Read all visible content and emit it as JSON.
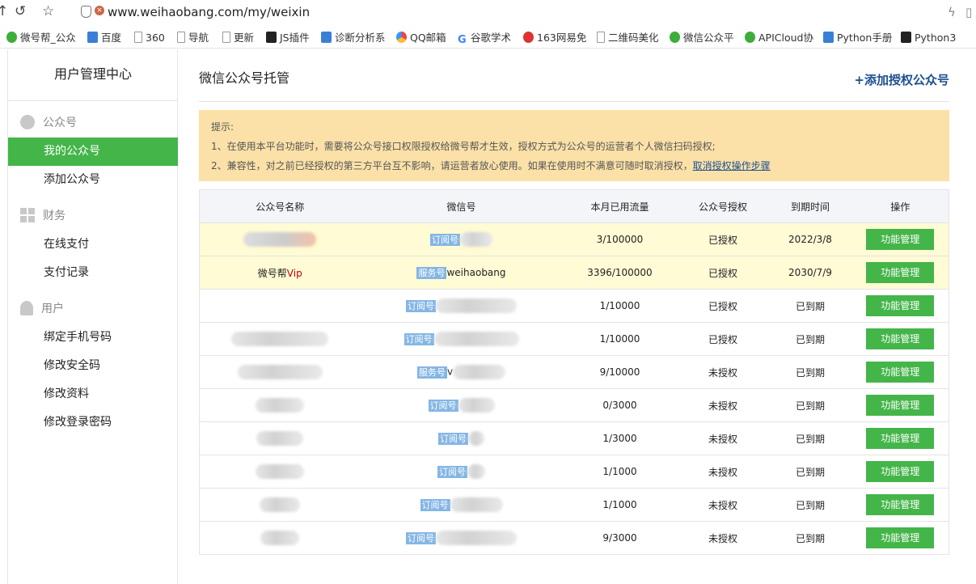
{
  "browser": {
    "url": "www.weihaobang.com/my/weixin",
    "bookmarks": [
      {
        "label": "微号帮_公众",
        "icon": "green"
      },
      {
        "label": "百度",
        "icon": "blue"
      },
      {
        "label": "360",
        "icon": "page"
      },
      {
        "label": "导航",
        "icon": "page"
      },
      {
        "label": "更新",
        "icon": "page"
      },
      {
        "label": "JS插件",
        "icon": "dark"
      },
      {
        "label": "诊断分析系",
        "icon": "blue"
      },
      {
        "label": "QQ邮箱",
        "icon": "multi"
      },
      {
        "label": "谷歌学术",
        "icon": "g"
      },
      {
        "label": "163网易免",
        "icon": "red"
      },
      {
        "label": "二维码美化",
        "icon": "page"
      },
      {
        "label": "微信公众平",
        "icon": "green"
      },
      {
        "label": "APICloud协",
        "icon": "green"
      },
      {
        "label": "Python手册",
        "icon": "blue"
      },
      {
        "label": "Python3",
        "icon": "dark"
      }
    ]
  },
  "sidebar": {
    "title": "用户管理中心",
    "sections": [
      {
        "label": "公众号",
        "icon": "chat-bubble-icon",
        "items": [
          "我的公众号",
          "添加公众号"
        ]
      },
      {
        "label": "财务",
        "icon": "grid-icon",
        "items": [
          "在线支付",
          "支付记录"
        ]
      },
      {
        "label": "用户",
        "icon": "user-icon",
        "items": [
          "绑定手机号码",
          "修改安全码",
          "修改资料",
          "修改登录密码"
        ]
      }
    ],
    "active_item": "我的公众号"
  },
  "main": {
    "title": "微信公众号托管",
    "add_link": "+添加授权公众号",
    "notice": {
      "heading": "提示:",
      "line1": "1、在使用本平台功能时，需要将公众号接口权限授权给微号帮才生效，授权方式为公众号的运营者个人微信扫码授权;",
      "line2": "2、兼容性，对之前已经授权的第三方平台互不影响，请运营者放心使用。如果在使用时不满意可随时取消授权，",
      "line2_link": "取消授权操作步骤"
    },
    "table": {
      "headers": [
        "公众号名称",
        "微信号",
        "本月已用流量",
        "公众号授权",
        "到期时间",
        "操作"
      ],
      "rows": [
        {
          "name": "",
          "name_vip": "",
          "type": "订阅号",
          "wxid": "",
          "traffic": "3/100000",
          "auth": "已授权",
          "expire": "2022/3/8",
          "action": "功能管理"
        },
        {
          "name": "微号帮",
          "name_vip": "Vip",
          "type": "服务号",
          "wxid": "weihaobang",
          "traffic": "3396/100000",
          "auth": "已授权",
          "expire": "2030/7/9",
          "action": "功能管理"
        },
        {
          "name": "",
          "name_vip": "",
          "type": "订阅号",
          "wxid": "",
          "traffic": "1/10000",
          "auth": "已授权",
          "expire": "已到期",
          "action": "功能管理"
        },
        {
          "name": "",
          "name_vip": "",
          "type": "订阅号",
          "wxid": "",
          "traffic": "1/10000",
          "auth": "已授权",
          "expire": "已到期",
          "action": "功能管理"
        },
        {
          "name": "",
          "name_vip": "",
          "type": "服务号",
          "wxid": "v",
          "traffic": "9/10000",
          "auth": "未授权",
          "expire": "已到期",
          "action": "功能管理"
        },
        {
          "name": "",
          "name_vip": "",
          "type": "订阅号",
          "wxid": "",
          "traffic": "0/3000",
          "auth": "未授权",
          "expire": "已到期",
          "action": "功能管理"
        },
        {
          "name": "",
          "name_vip": "",
          "type": "订阅号",
          "wxid": "",
          "traffic": "1/3000",
          "auth": "未授权",
          "expire": "已到期",
          "action": "功能管理"
        },
        {
          "name": "",
          "name_vip": "",
          "type": "订阅号",
          "wxid": "",
          "traffic": "1/1000",
          "auth": "未授权",
          "expire": "已到期",
          "action": "功能管理"
        },
        {
          "name": "",
          "name_vip": "",
          "type": "订阅号",
          "wxid": "",
          "traffic": "1/1000",
          "auth": "未授权",
          "expire": "已到期",
          "action": "功能管理"
        },
        {
          "name": "",
          "name_vip": "",
          "type": "订阅号",
          "wxid": "",
          "traffic": "9/3000",
          "auth": "未授权",
          "expire": "已到期",
          "action": "功能管理"
        }
      ]
    }
  },
  "colors": {
    "green": "#44b549",
    "auth_ok": "#178a16",
    "red": "#c40000",
    "link": "#1d4f91",
    "notice_bg": "#fbe1a8"
  }
}
